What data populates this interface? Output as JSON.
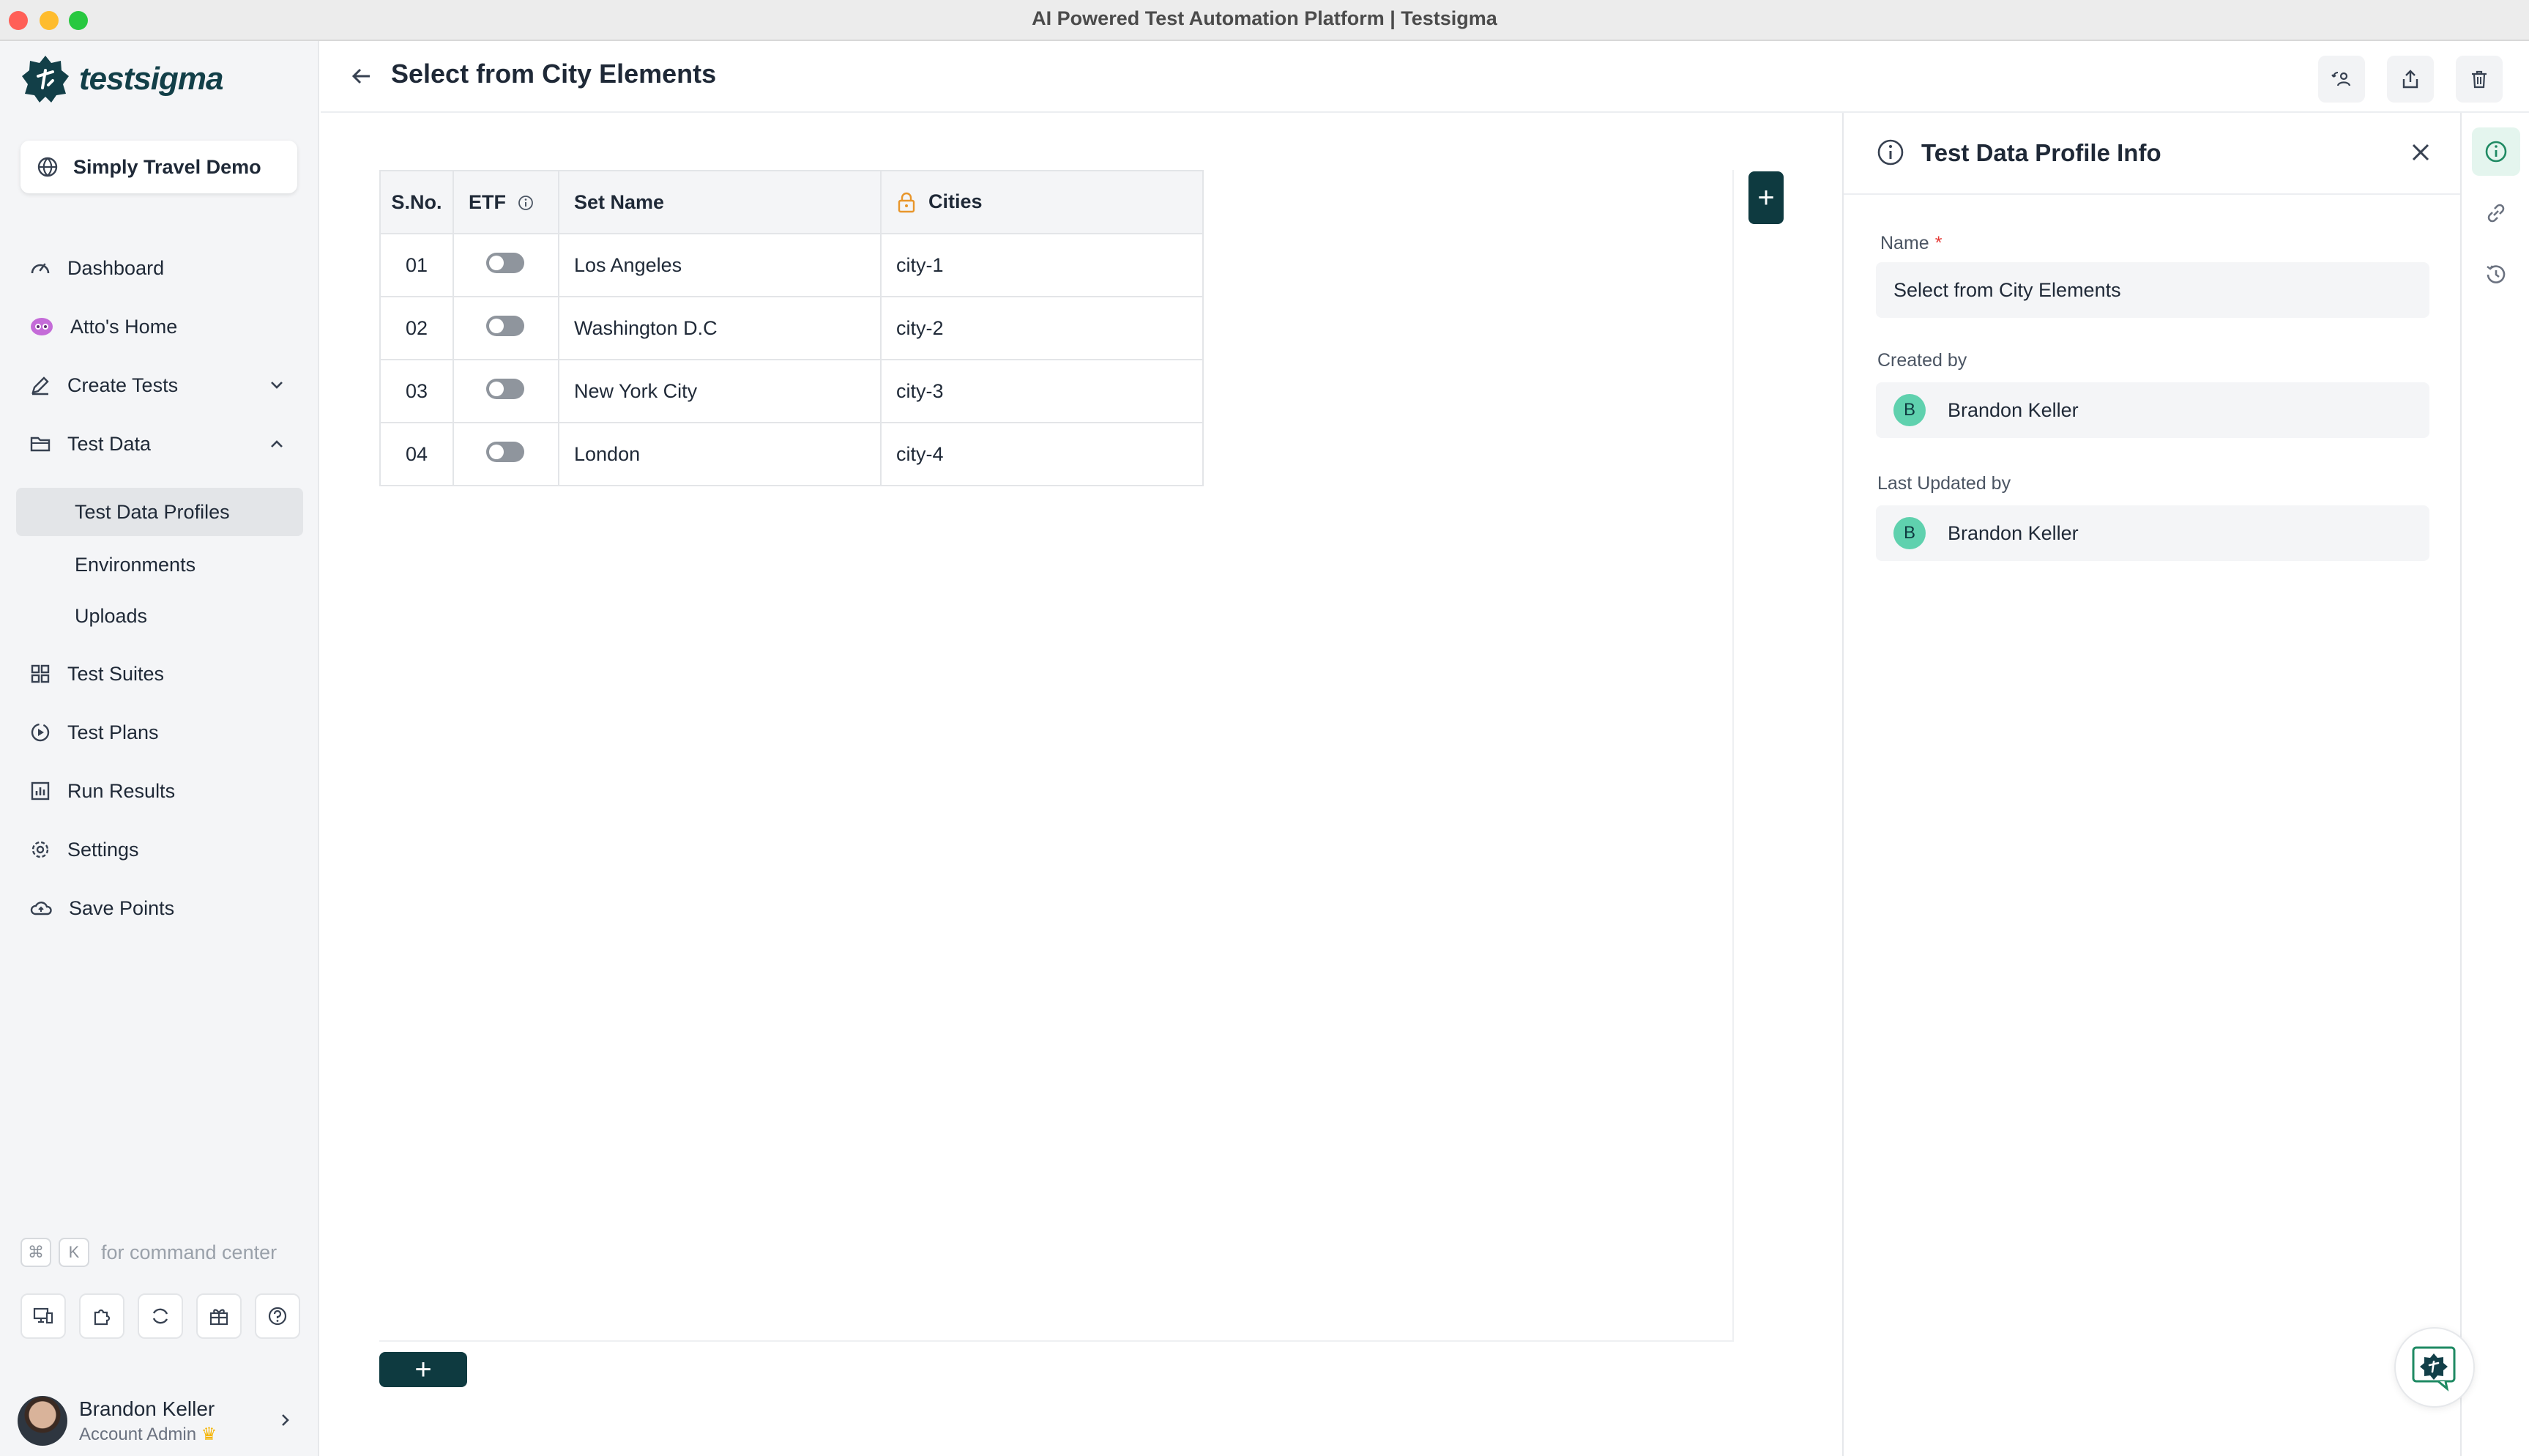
{
  "window": {
    "title": "AI Powered Test Automation Platform | Testsigma"
  },
  "brand": {
    "name": "testsigma",
    "color": "#123f48",
    "accent": "#0e3a40"
  },
  "project": {
    "name": "Simply Travel Demo"
  },
  "nav": {
    "dashboard": "Dashboard",
    "attos_home": "Atto's Home",
    "create_tests": "Create Tests",
    "test_data": "Test Data",
    "test_data_profiles": "Test Data Profiles",
    "environments": "Environments",
    "uploads": "Uploads",
    "test_suites": "Test Suites",
    "test_plans": "Test Plans",
    "run_results": "Run Results",
    "settings": "Settings",
    "save_points": "Save Points"
  },
  "command_center": {
    "key1": "⌘",
    "key2": "K",
    "text": "for command center"
  },
  "user": {
    "name": "Brandon Keller",
    "role": "Account Admin",
    "crown": "♛"
  },
  "header": {
    "title": "Select from City Elements"
  },
  "table": {
    "columns": {
      "sno": "S.No.",
      "etf": "ETF",
      "set_name": "Set Name",
      "cities": "Cities"
    },
    "rows": [
      {
        "sno": "01",
        "set_name": "Los Angeles",
        "city": "city-1"
      },
      {
        "sno": "02",
        "set_name": "Washington D.C",
        "city": "city-2"
      },
      {
        "sno": "03",
        "set_name": "New York City",
        "city": "city-3"
      },
      {
        "sno": "04",
        "set_name": "London",
        "city": "city-4"
      }
    ]
  },
  "buttons": {
    "add_column": "+",
    "add_row": "+"
  },
  "panel": {
    "title": "Test Data Profile Info",
    "name_label": "Name",
    "required_mark": "*",
    "name_value": "Select from City Elements",
    "created_by_label": "Created by",
    "created_by": "Brandon Keller",
    "created_by_initial": "B",
    "updated_by_label": "Last Updated by",
    "updated_by": "Brandon Keller",
    "updated_by_initial": "B"
  }
}
